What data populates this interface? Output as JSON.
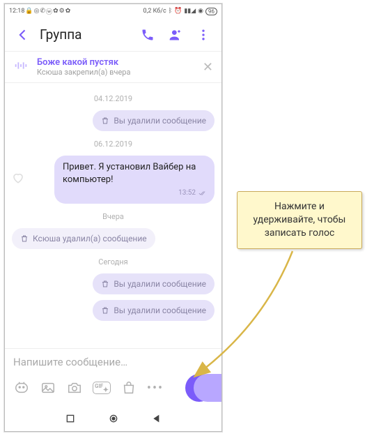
{
  "status": {
    "time": "12:18",
    "speed": "0,2 Кб/с",
    "battery": "96"
  },
  "header": {
    "title": "Группа"
  },
  "pinned": {
    "title": "Боже какой пустяк",
    "sub": "Ксюша закрепил(а) вчера"
  },
  "dates": {
    "d1": "04.12.2019",
    "d2": "06.12.2019",
    "d3": "Вчера",
    "d4": "Сегодня"
  },
  "messages": {
    "deleted_you": "Вы удалили сообщение",
    "deleted_other": "Ксюша удалил(а) сообщение",
    "m1": "Привет. Я установил Вайбер на компьютер!",
    "t1": "13:52"
  },
  "compose": {
    "placeholder": "Напишите сообщение…",
    "gif": "GIF"
  },
  "callout": {
    "text": "Нажмите и удерживайте, чтобы записать голос"
  }
}
